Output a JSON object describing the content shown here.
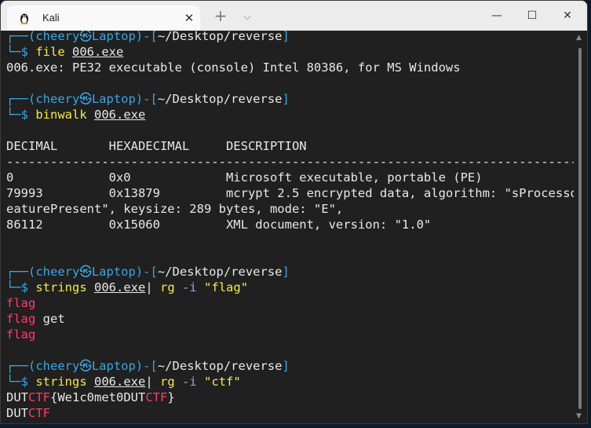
{
  "window": {
    "tab_title": "Kali",
    "new_tab": "+",
    "dropdown": "⌵",
    "minimize": "—",
    "maximize": "☐",
    "close": "✕",
    "tab_close": "✕"
  },
  "prompt": {
    "open": "┌──(",
    "user": "cheery",
    "at": "㉿",
    "host": "Laptop",
    "close_user": ")-[",
    "path": "~/Desktop/reverse",
    "close_path": "]",
    "dollar_prefix": "└─$ "
  },
  "blocks": {
    "b1": {
      "cmd": "file",
      "arg": "006.exe",
      "output": "006.exe: PE32 executable (console) Intel 80386, for MS Windows"
    },
    "b2": {
      "cmd": "binwalk",
      "arg": "006.exe",
      "header": "DECIMAL       HEXADECIMAL     DESCRIPTION",
      "rule": "------------------------------------------------------------------------------------------------",
      "rows": [
        "0             0x0             Microsoft executable, portable (PE)",
        "79993         0x13879         mcrypt 2.5 encrypted data, algorithm: \"sProcessorF",
        "eaturePresent\", keysize: 289 bytes, mode: \"E\",",
        "86112         0x15060         XML document, version: \"1.0\""
      ]
    },
    "b3": {
      "cmd": "strings",
      "arg": "006.exe",
      "pipe": "|",
      "tool": "rg",
      "flag": "-i",
      "pattern": "\"flag\"",
      "out1": "flag",
      "out2_match": "flag",
      "out2_rest": " get",
      "out3": "flag"
    },
    "b4": {
      "cmd": "strings",
      "arg": "006.exe",
      "pipe": "|",
      "tool": "rg",
      "flag": "-i",
      "pattern": "\"ctf\"",
      "o1_a": "DUT",
      "o1_b": "CTF",
      "o1_c": "{We1c0met0DUT",
      "o1_d": "CTF",
      "o1_e": "}",
      "o2_a": "DUT",
      "o2_b": "CTF"
    }
  },
  "colors": {
    "prompt": "#3aa6e6",
    "command": "#f5e94f",
    "option": "#c490e8",
    "match": "#ff3d6e",
    "background": "#202020"
  }
}
